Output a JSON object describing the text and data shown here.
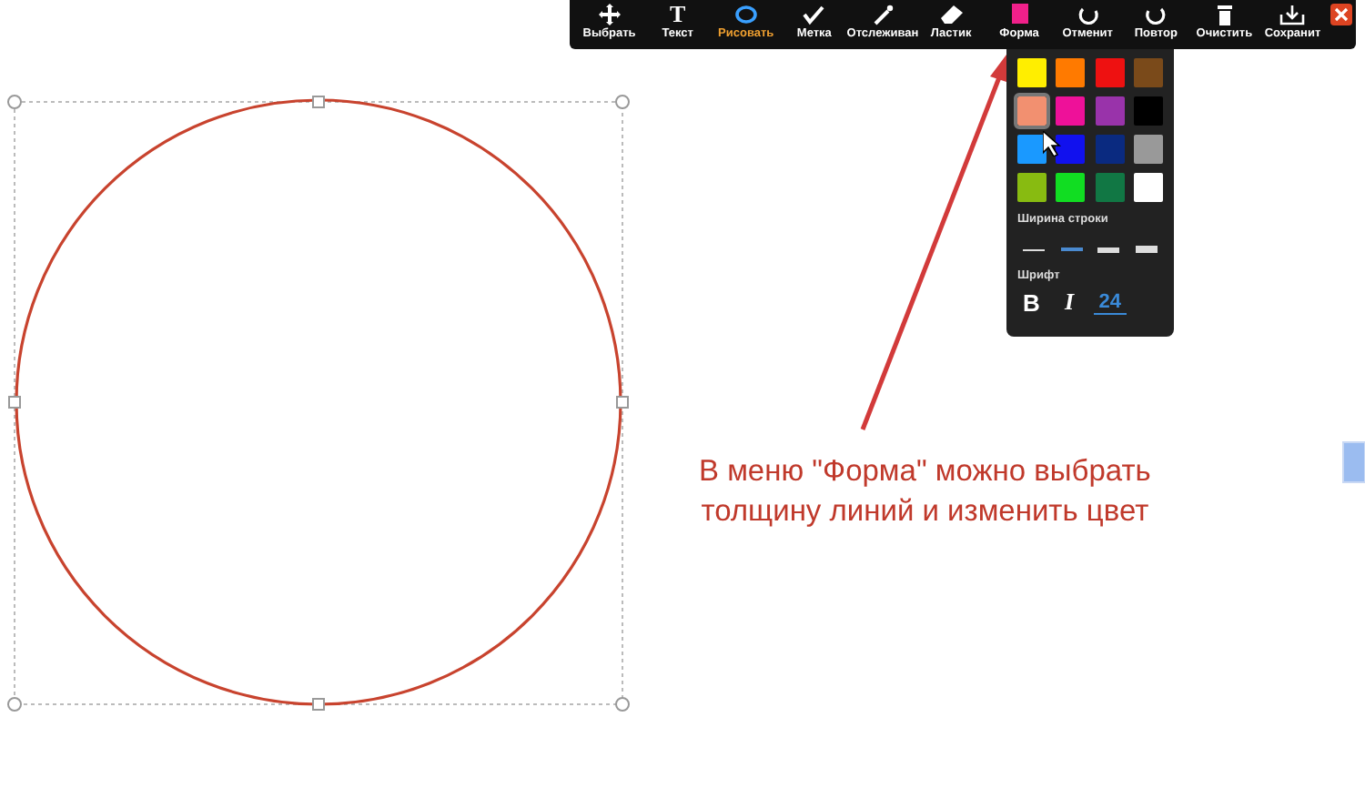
{
  "toolbar": {
    "tools": [
      {
        "kind": "move",
        "label": "Выбрать",
        "selected": false
      },
      {
        "kind": "text",
        "glyph": "T",
        "label": "Текст",
        "selected": false
      },
      {
        "kind": "ellipse",
        "label": "Рисовать",
        "selected": true
      },
      {
        "kind": "check",
        "label": "Метка",
        "selected": false
      },
      {
        "kind": "pen",
        "label": "Отслеживан",
        "selected": false
      },
      {
        "kind": "eraser",
        "label": "Ластик",
        "selected": false
      },
      {
        "kind": "square",
        "label": "Форма",
        "selected": false
      },
      {
        "kind": "undo",
        "label": "Отменит",
        "selected": false
      },
      {
        "kind": "redo",
        "label": "Повтор",
        "selected": false
      },
      {
        "kind": "trash",
        "label": "Очистить",
        "selected": false
      },
      {
        "kind": "save",
        "label": "Сохранит",
        "selected": false
      }
    ]
  },
  "shape_menu": {
    "colors": [
      {
        "color": "#ffee00",
        "selected": false
      },
      {
        "color": "#ff7a00",
        "selected": false
      },
      {
        "color": "#ee1111",
        "selected": false
      },
      {
        "color": "#7a4a1a",
        "selected": false
      },
      {
        "color": "#f29070",
        "selected": true
      },
      {
        "color": "#ee1199",
        "selected": false
      },
      {
        "color": "#9933aa",
        "selected": false
      },
      {
        "color": "#000000",
        "selected": false
      },
      {
        "color": "#1a99ff",
        "selected": false
      },
      {
        "color": "#1111ee",
        "selected": false
      },
      {
        "color": "#0a2a80",
        "selected": false
      },
      {
        "color": "#999999",
        "selected": false
      },
      {
        "color": "#88bb11",
        "selected": false
      },
      {
        "color": "#11dd22",
        "selected": false
      },
      {
        "color": "#117744",
        "selected": false
      },
      {
        "color": "#ffffff",
        "selected": false
      }
    ],
    "line_width_label": "Ширина строки",
    "line_widths": [
      {
        "selected": false
      },
      {
        "selected": true
      },
      {
        "selected": false
      },
      {
        "selected": false
      }
    ],
    "font_label": "Шрифт",
    "bold": "B",
    "italic": "I",
    "size": "24"
  },
  "annotation": [
    "В меню \"Форма\" можно выбрать",
    "толщину линий и изменить цвет"
  ]
}
